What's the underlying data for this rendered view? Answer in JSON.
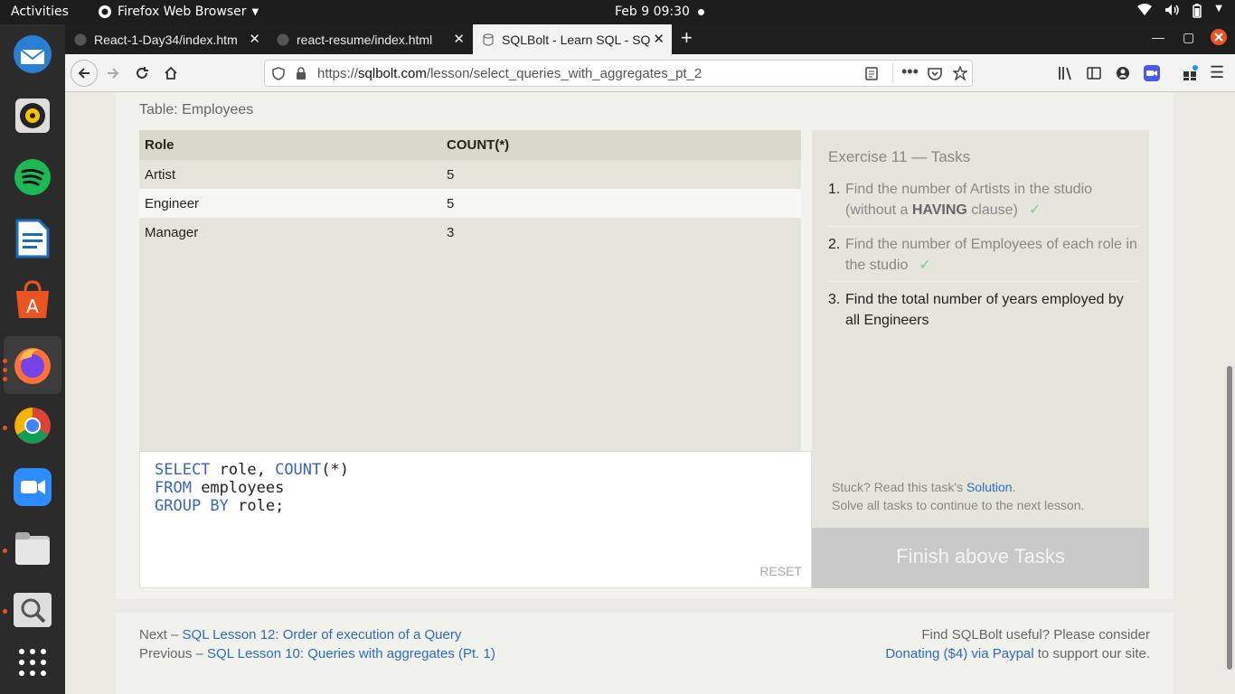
{
  "topbar": {
    "activities": "Activities",
    "app_name": "Firefox Web Browser",
    "clock": "Feb 9  09:30"
  },
  "dock": {
    "apps": [
      "thunderbird",
      "rhythmbox",
      "spotify",
      "libreoffice-writer",
      "ubuntu-software",
      "firefox",
      "chrome",
      "zoom",
      "files",
      "screenshot",
      "show-applications"
    ]
  },
  "tabs": [
    {
      "title": "React-1-Day34/index.htm",
      "icon": "github-icon"
    },
    {
      "title": "react-resume/index.html",
      "icon": "github-icon"
    },
    {
      "title": "SQLBolt - Learn SQL - SQ",
      "icon": "database-icon"
    }
  ],
  "url": {
    "prefix": "https://",
    "domain": "sqlbolt.com",
    "path": "/lesson/select_queries_with_aggregates_pt_2"
  },
  "lesson": {
    "table_caption": "Table: Employees",
    "columns": [
      "Role",
      "COUNT(*)"
    ],
    "rows": [
      [
        "Artist",
        "5"
      ],
      [
        "Engineer",
        "5"
      ],
      [
        "Manager",
        "3"
      ]
    ],
    "query_lines": [
      {
        "kw1": "SELECT",
        "rest1": " role, ",
        "kw2": "COUNT",
        "rest2": "(*)"
      },
      {
        "kw1": "FROM",
        "rest1": " employees",
        "kw2": "",
        "rest2": ""
      },
      {
        "kw1": "GROUP BY",
        "rest1": " role;",
        "kw2": "",
        "rest2": ""
      }
    ],
    "reset_label": "RESET"
  },
  "tasks": {
    "title": "Exercise 11 — Tasks",
    "items": [
      {
        "num": "1.",
        "text_a": "Find the number of Artists in the studio (without a ",
        "bold": "HAVING",
        "text_b": " clause)",
        "check": "✓"
      },
      {
        "num": "2.",
        "text_a": "Find the number of Employees of each role in the studio",
        "bold": "",
        "text_b": "",
        "check": "✓"
      },
      {
        "num": "3.",
        "text_a": "Find the total number of years employed by all Engineers",
        "bold": "",
        "text_b": "",
        "check": ""
      }
    ],
    "stuck_prefix": "Stuck? Read this task's ",
    "solution_link": "Solution",
    "stuck_suffix": ".",
    "solve_all": "Solve all tasks to continue to the next lesson.",
    "finish_button": "Finish above Tasks"
  },
  "footer": {
    "next_prefix": "Next – ",
    "next_link": "SQL Lesson 12: Order of execution of a Query",
    "prev_prefix": "Previous – ",
    "prev_link": "SQL Lesson 10: Queries with aggregates (Pt. 1)",
    "useful": "Find SQLBolt useful? Please consider",
    "donate_link": "Donating ($4) via Paypal",
    "donate_suffix": " to support our site."
  },
  "colors": {
    "accent_link": "#2d6bbf",
    "keyword": "#3a66b8",
    "check": "#8bc78b"
  }
}
